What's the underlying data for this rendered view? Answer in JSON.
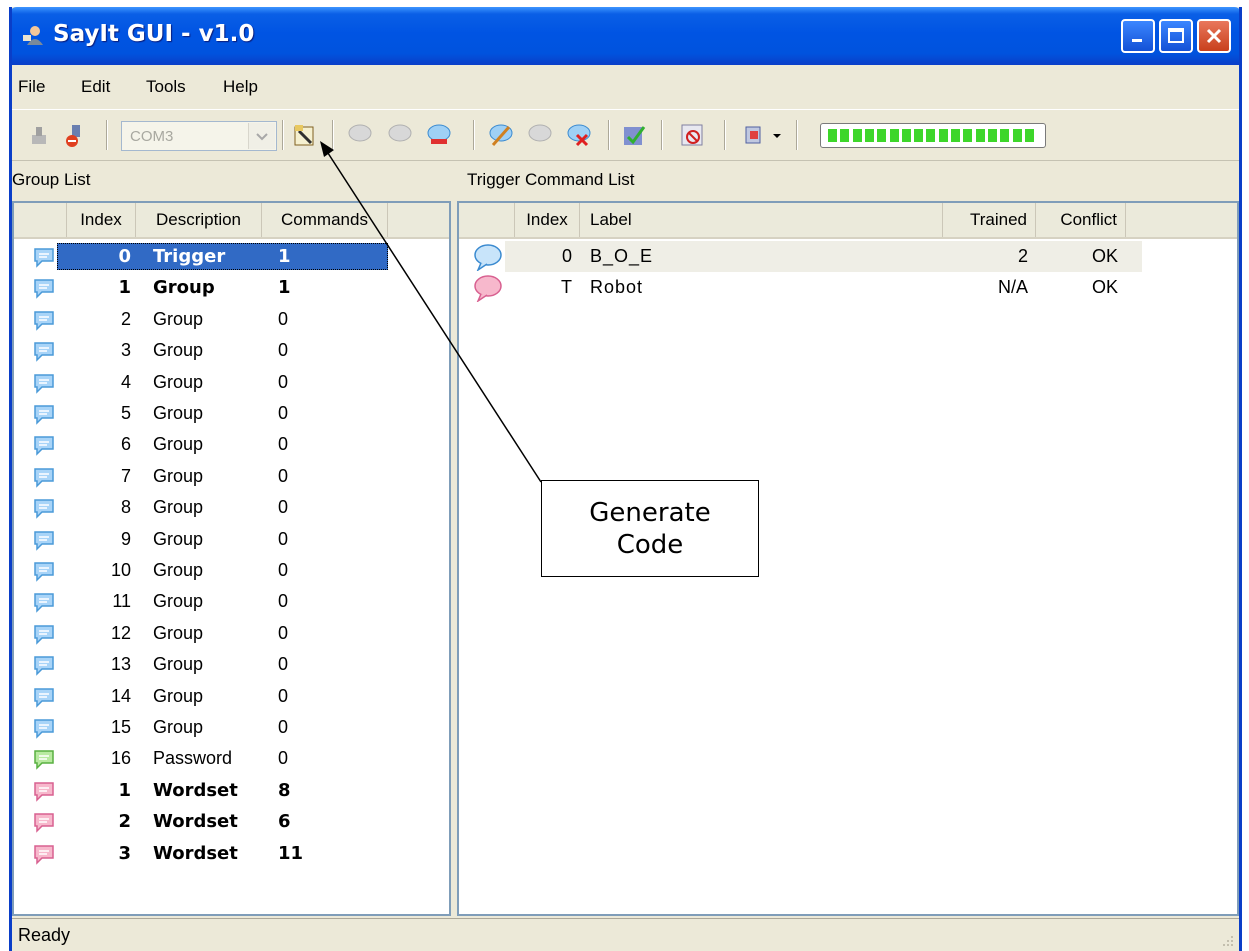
{
  "window": {
    "title": "SayIt GUI - v1.0"
  },
  "menu": [
    "File",
    "Edit",
    "Tools",
    "Help"
  ],
  "toolbar": {
    "port_value": "COM3"
  },
  "group_list": {
    "title": "Group List",
    "columns": [
      "Index",
      "Description",
      "Commands"
    ],
    "rows": [
      {
        "index": "0",
        "description": "Trigger",
        "commands": "1",
        "bold": true,
        "selected": true,
        "color": "blue"
      },
      {
        "index": "1",
        "description": "Group",
        "commands": "1",
        "bold": true,
        "color": "blue"
      },
      {
        "index": "2",
        "description": "Group",
        "commands": "0",
        "color": "blue"
      },
      {
        "index": "3",
        "description": "Group",
        "commands": "0",
        "color": "blue"
      },
      {
        "index": "4",
        "description": "Group",
        "commands": "0",
        "color": "blue"
      },
      {
        "index": "5",
        "description": "Group",
        "commands": "0",
        "color": "blue"
      },
      {
        "index": "6",
        "description": "Group",
        "commands": "0",
        "color": "blue"
      },
      {
        "index": "7",
        "description": "Group",
        "commands": "0",
        "color": "blue"
      },
      {
        "index": "8",
        "description": "Group",
        "commands": "0",
        "color": "blue"
      },
      {
        "index": "9",
        "description": "Group",
        "commands": "0",
        "color": "blue"
      },
      {
        "index": "10",
        "description": "Group",
        "commands": "0",
        "color": "blue"
      },
      {
        "index": "11",
        "description": "Group",
        "commands": "0",
        "color": "blue"
      },
      {
        "index": "12",
        "description": "Group",
        "commands": "0",
        "color": "blue"
      },
      {
        "index": "13",
        "description": "Group",
        "commands": "0",
        "color": "blue"
      },
      {
        "index": "14",
        "description": "Group",
        "commands": "0",
        "color": "blue"
      },
      {
        "index": "15",
        "description": "Group",
        "commands": "0",
        "color": "blue"
      },
      {
        "index": "16",
        "description": "Password",
        "commands": "0",
        "color": "green"
      },
      {
        "index": "1",
        "description": "Wordset",
        "commands": "8",
        "bold": true,
        "color": "pink"
      },
      {
        "index": "2",
        "description": "Wordset",
        "commands": "6",
        "bold": true,
        "color": "pink"
      },
      {
        "index": "3",
        "description": "Wordset",
        "commands": "11",
        "bold": true,
        "color": "pink"
      }
    ]
  },
  "command_list": {
    "title": "Trigger Command List",
    "columns": [
      "Index",
      "Label",
      "Trained",
      "Conflict"
    ],
    "rows": [
      {
        "index": "0",
        "label": "B_O_E",
        "trained": "2",
        "conflict": "OK",
        "color": "blue",
        "shaded": true
      },
      {
        "index": "T",
        "label": "Robot",
        "trained": "N/A",
        "conflict": "OK",
        "color": "pink"
      }
    ]
  },
  "status": {
    "text": "Ready"
  },
  "callout": {
    "line1": "Generate",
    "line2": "Code"
  },
  "colors": {
    "title_bar": "#0054e3",
    "selection": "#316ac5",
    "level_segment": "#3dd62a"
  }
}
